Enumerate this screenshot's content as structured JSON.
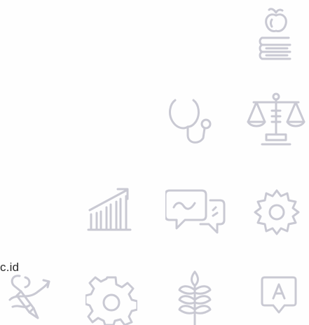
{
  "fragment_text": "c.id",
  "icons": [
    {
      "name": "book-apple-icon"
    },
    {
      "name": "stethoscope-icon"
    },
    {
      "name": "scales-icon"
    },
    {
      "name": "bar-chart-growth-icon"
    },
    {
      "name": "chat-bubbles-icon"
    },
    {
      "name": "gear-outline-icon"
    },
    {
      "name": "pencil-ribbon-icon"
    },
    {
      "name": "cog-icon"
    },
    {
      "name": "wheat-icon"
    },
    {
      "name": "message-a-icon"
    }
  ],
  "colors": {
    "icon_stroke": "#c9c9d3",
    "text": "#2a2a2a",
    "background": "#fefefe"
  }
}
